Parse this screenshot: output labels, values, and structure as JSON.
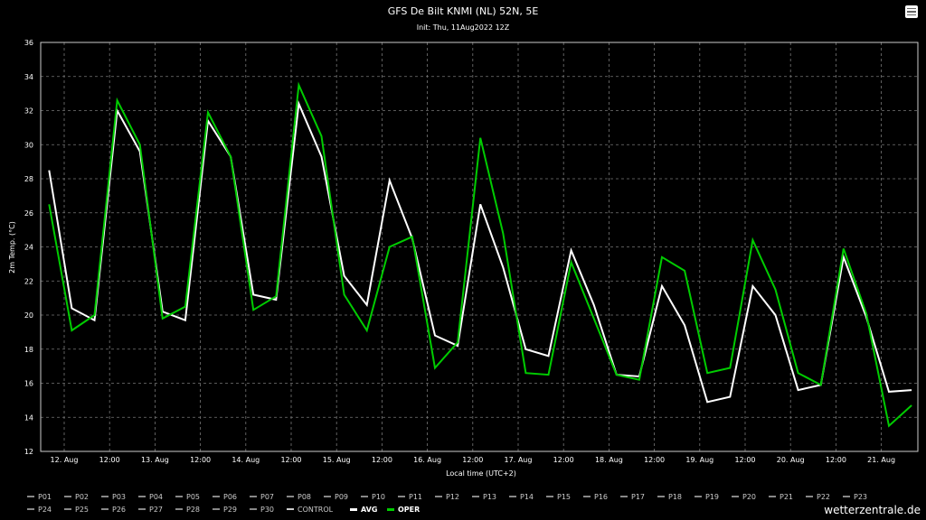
{
  "chart_data": {
    "type": "line",
    "title": "GFS De Bilt KNMI (NL) 52N, 5E",
    "subtitle": "Init: Thu, 11Aug2022 12Z",
    "xlabel": "Local time (UTC+2)",
    "ylabel": "2m Temp. (°C)",
    "ylim": [
      12,
      36
    ],
    "yticks": [
      "12",
      "14",
      "16",
      "18",
      "20",
      "22",
      "24",
      "26",
      "28",
      "30",
      "32",
      "34",
      "36"
    ],
    "xtick_labels": [
      "12. Aug",
      "12:00",
      "13. Aug",
      "12:00",
      "14. Aug",
      "12:00",
      "15. Aug",
      "12:00",
      "16. Aug",
      "12:00",
      "17. Aug",
      "12:00",
      "18. Aug",
      "12:00",
      "19. Aug",
      "12:00",
      "20. Aug",
      "12:00",
      "21. Aug"
    ],
    "x_hours_from_12aug_0000": [
      -4,
      2,
      8,
      14,
      20,
      26,
      32,
      38,
      44,
      50,
      56,
      62,
      68,
      74,
      80,
      86,
      92,
      98,
      104,
      110,
      116,
      122,
      128,
      134,
      140,
      146,
      152,
      158,
      164,
      170,
      176,
      182,
      188,
      194,
      200,
      206,
      212,
      218,
      224
    ],
    "grid": true,
    "series": [
      {
        "name": "AVG",
        "color": "#ffffff",
        "values": [
          28.5,
          20.4,
          19.7,
          32.0,
          29.6,
          20.2,
          19.7,
          31.4,
          29.3,
          21.2,
          20.9,
          32.4,
          29.3,
          22.3,
          20.6,
          27.9,
          24.5,
          18.8,
          18.2,
          26.5,
          22.8,
          18.0,
          17.6,
          23.8,
          20.6,
          16.5,
          16.4,
          21.7,
          19.4,
          14.9,
          15.2,
          21.7,
          20.0,
          15.6,
          15.9,
          23.4,
          19.9,
          15.5,
          15.6
        ]
      },
      {
        "name": "OPER",
        "color": "#00cc00",
        "values": [
          26.5,
          19.1,
          20.0,
          32.6,
          30.0,
          19.8,
          20.5,
          31.9,
          29.3,
          20.3,
          21.1,
          33.5,
          30.5,
          21.2,
          19.1,
          24.0,
          24.6,
          16.9,
          18.4,
          30.4,
          24.8,
          16.6,
          16.5,
          23.1,
          19.8,
          16.5,
          16.2,
          23.4,
          22.6,
          16.6,
          16.9,
          24.4,
          21.5,
          16.6,
          15.9,
          23.9,
          20.1,
          13.5,
          14.7
        ]
      }
    ],
    "legend": {
      "placement": "bottom",
      "entries": [
        "P01",
        "P02",
        "P03",
        "P04",
        "P05",
        "P06",
        "P07",
        "P08",
        "P09",
        "P10",
        "P11",
        "P12",
        "P13",
        "P14",
        "P15",
        "P16",
        "P17",
        "P18",
        "P19",
        "P20",
        "P21",
        "P22",
        "P23",
        "P24",
        "P25",
        "P26",
        "P27",
        "P28",
        "P29",
        "P30",
        "CONTROL",
        "AVG",
        "OPER"
      ],
      "colors": {
        "default": "#888888",
        "CONTROL": "#cccccc",
        "AVG": "#ffffff",
        "OPER": "#00cc00"
      }
    }
  },
  "credit": "wetterzentrale.de"
}
